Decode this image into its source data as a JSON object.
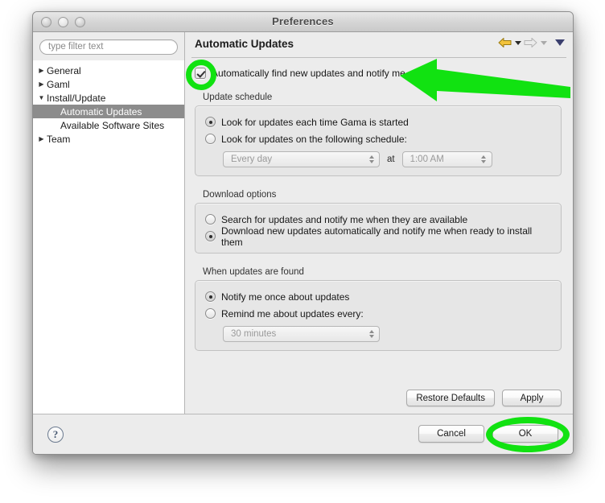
{
  "window": {
    "title": "Preferences",
    "traffic_lights": [
      "close-button",
      "minimize-button",
      "maximize-button"
    ]
  },
  "sidebar": {
    "filter": {
      "value": "",
      "placeholder": "type filter text"
    },
    "items": [
      {
        "label": "General",
        "level": 1,
        "twisty": "▶",
        "selected": false
      },
      {
        "label": "Gaml",
        "level": 1,
        "twisty": "▶",
        "selected": false
      },
      {
        "label": "Install/Update",
        "level": 1,
        "twisty": "▼",
        "selected": false
      },
      {
        "label": "Automatic Updates",
        "level": 2,
        "twisty": "",
        "selected": true
      },
      {
        "label": "Available Software Sites",
        "level": 2,
        "twisty": "",
        "selected": false
      },
      {
        "label": "Team",
        "level": 1,
        "twisty": "▶",
        "selected": false
      }
    ]
  },
  "pane": {
    "title": "Automatic Updates",
    "nav": {
      "back_icon": "back-arrow-icon",
      "forward_icon": "forward-arrow-icon",
      "menu_icon": "view-menu-icon"
    },
    "enable_checkbox": {
      "label": "Automatically find new updates and notify me",
      "checked": true
    },
    "groups": [
      {
        "label": "Update schedule",
        "options": [
          {
            "label": "Look for updates each time Gama is started",
            "selected": true
          },
          {
            "label": "Look for updates on the following schedule:",
            "selected": false
          }
        ],
        "selects": [
          {
            "name": "schedule-frequency",
            "value": "Every day",
            "enabled": false
          },
          {
            "name": "schedule-time",
            "value": "1:00 AM",
            "enabled": false
          }
        ],
        "between_label": "at"
      },
      {
        "label": "Download options",
        "options": [
          {
            "label": "Search for updates and notify me when they are available",
            "selected": false
          },
          {
            "label": "Download new updates automatically and notify me when ready to install them",
            "selected": true
          }
        ],
        "selects": []
      },
      {
        "label": "When updates are found",
        "options": [
          {
            "label": "Notify me once about updates",
            "selected": true
          },
          {
            "label": "Remind me about updates every:",
            "selected": false
          }
        ],
        "selects": [
          {
            "name": "remind-interval",
            "value": "30 minutes",
            "enabled": false
          }
        ]
      }
    ],
    "buttons": [
      {
        "name": "restore-defaults-button",
        "label": "Restore Defaults"
      },
      {
        "name": "apply-button",
        "label": "Apply"
      }
    ]
  },
  "footer": {
    "help_label": "?",
    "buttons": [
      {
        "name": "cancel-button",
        "label": "Cancel"
      },
      {
        "name": "ok-button",
        "label": "OK"
      }
    ]
  },
  "annotations": {
    "highlight_color": "#11e211",
    "items": [
      {
        "name": "checkbox-highlight",
        "shape": "circle"
      },
      {
        "name": "pointer-arrow",
        "shape": "arrow",
        "direction": "left"
      },
      {
        "name": "ok-button-highlight",
        "shape": "ellipse"
      }
    ]
  }
}
